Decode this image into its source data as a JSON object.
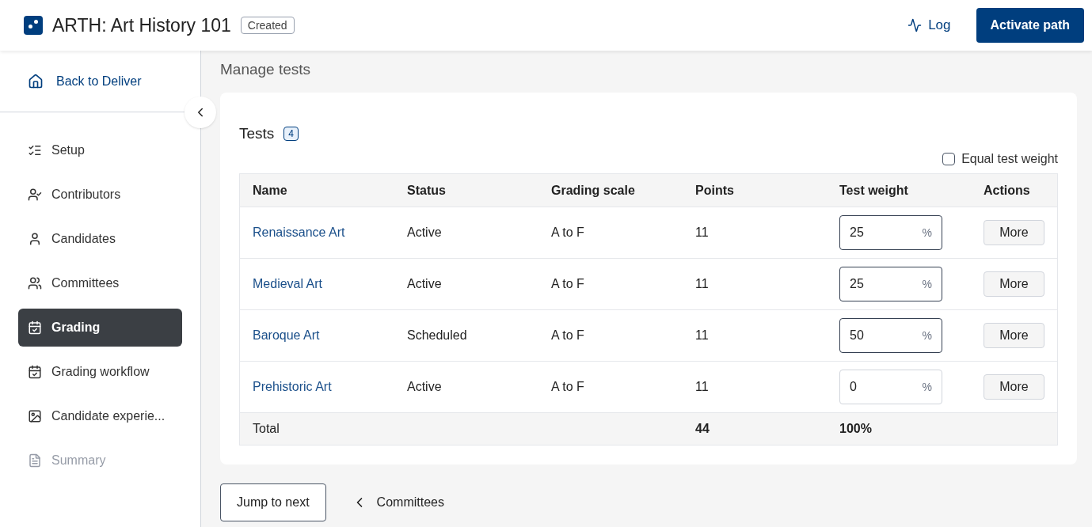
{
  "header": {
    "title": "ARTH: Art History 101",
    "status_badge": "Created",
    "log_link": "Log",
    "primary_button": "Activate path"
  },
  "sidebar": {
    "back_link": "Back to Deliver",
    "items": [
      {
        "label": "Setup",
        "selected": false,
        "disabled": false
      },
      {
        "label": "Contributors",
        "selected": false,
        "disabled": false
      },
      {
        "label": "Candidates",
        "selected": false,
        "disabled": false
      },
      {
        "label": "Committees",
        "selected": false,
        "disabled": false
      },
      {
        "label": "Grading",
        "selected": true,
        "disabled": false
      },
      {
        "label": "Grading workflow",
        "selected": false,
        "disabled": false
      },
      {
        "label": "Candidate experie...",
        "selected": false,
        "disabled": false
      },
      {
        "label": "Summary",
        "selected": false,
        "disabled": true
      }
    ]
  },
  "page_title": "Manage tests",
  "tests_card": {
    "title": "Tests",
    "count": "4",
    "equal_weight": {
      "label": "Equal test weight",
      "checked": false
    },
    "columns": [
      "Name",
      "Status",
      "Grading scale",
      "Points",
      "Test weight",
      "Actions"
    ],
    "rows": [
      {
        "name": "Renaissance Art",
        "status": "Active",
        "grading_scale": "A to F",
        "points": "11",
        "weight": "25",
        "unit": "%",
        "emphasized": true,
        "action": "More"
      },
      {
        "name": "Medieval Art",
        "status": "Active",
        "grading_scale": "A to F",
        "points": "11",
        "weight": "25",
        "unit": "%",
        "emphasized": true,
        "action": "More"
      },
      {
        "name": "Baroque Art",
        "status": "Scheduled",
        "grading_scale": "A to F",
        "points": "11",
        "weight": "50",
        "unit": "%",
        "emphasized": true,
        "action": "More"
      },
      {
        "name": "Prehistoric Art",
        "status": "Active",
        "grading_scale": "A to F",
        "points": "11",
        "weight": "0",
        "unit": "%",
        "emphasized": false,
        "action": "More"
      }
    ],
    "total": {
      "label": "Total",
      "points": "44",
      "weight": "100%"
    }
  },
  "footer": {
    "jump_button": "Jump to next",
    "back_link": "Committees"
  }
}
